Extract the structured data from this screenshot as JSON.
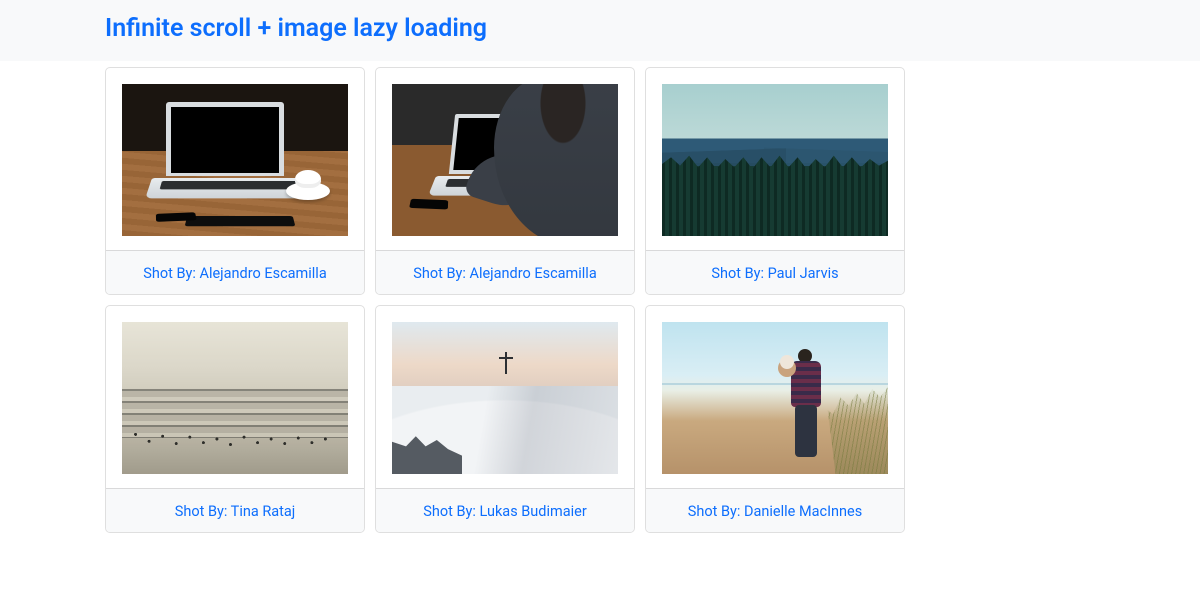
{
  "header": {
    "title": "Infinite scroll + image lazy loading"
  },
  "caption_prefix": "Shot By: ",
  "cards": [
    {
      "author": "Alejandro Escamilla"
    },
    {
      "author": "Alejandro Escamilla"
    },
    {
      "author": "Paul Jarvis"
    },
    {
      "author": "Tina Rataj"
    },
    {
      "author": "Lukas Budimaier"
    },
    {
      "author": "Danielle MacInnes"
    }
  ]
}
